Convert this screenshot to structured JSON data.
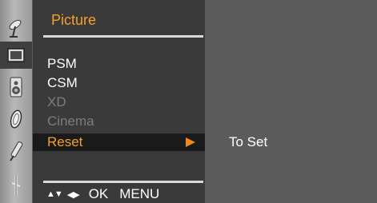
{
  "menu": {
    "title": "Picture",
    "items": [
      {
        "label": "PSM",
        "state": "enabled"
      },
      {
        "label": "CSM",
        "state": "enabled"
      },
      {
        "label": "XD",
        "state": "disabled"
      },
      {
        "label": "Cinema",
        "state": "disabled"
      },
      {
        "label": "Reset",
        "state": "selected"
      }
    ]
  },
  "hint_bar": {
    "updown_glyph": "▲▼",
    "leftright_glyph": "◀▶",
    "ok_label": "OK",
    "menu_label": "MENU"
  },
  "submenu": {
    "label": "To Set"
  },
  "sidebar": {
    "icons": [
      "satellite-dish-icon",
      "picture-icon",
      "speaker-icon",
      "clock-icon",
      "tool-icon",
      "input-plug-icon"
    ]
  },
  "colors": {
    "accent": "#f5a02a",
    "arrow": "#f08a1a",
    "panel": "#3a3a3a",
    "selection": "#1a1a1a",
    "disabled_text": "#7c7c7c"
  }
}
